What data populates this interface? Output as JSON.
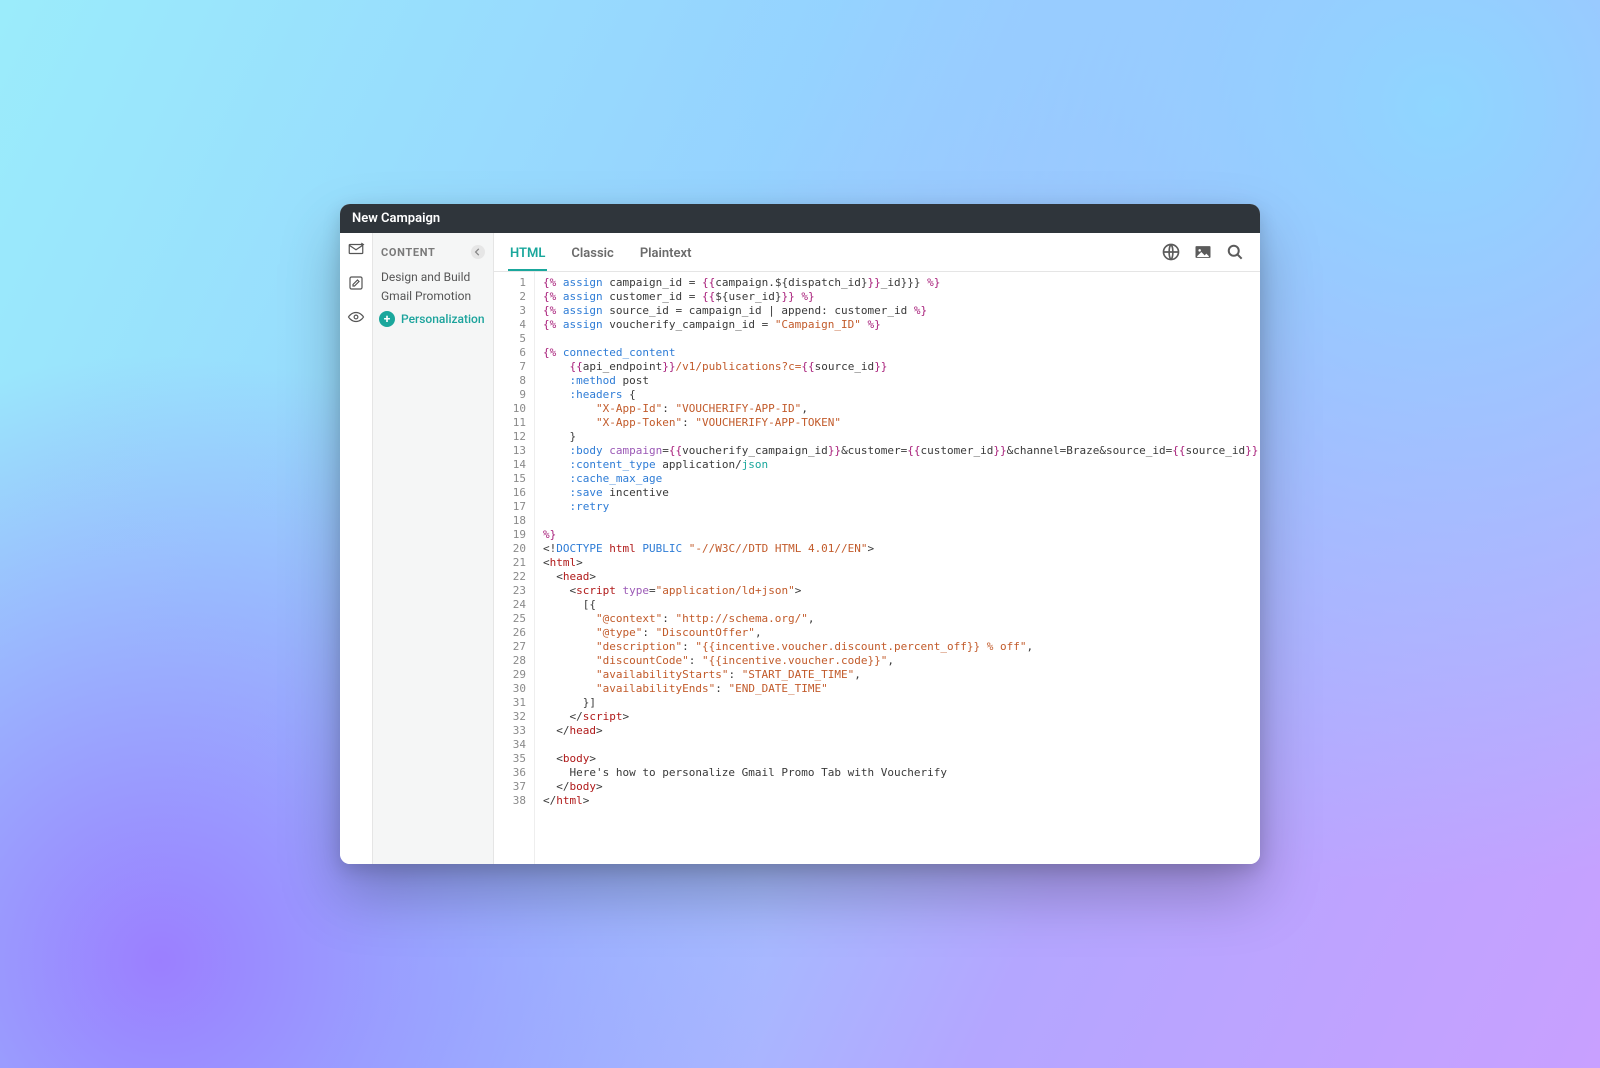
{
  "window": {
    "title": "New Campaign"
  },
  "panel": {
    "header": "CONTENT",
    "items": [
      "Design and Build",
      "Gmail Promotion",
      "Personalization"
    ]
  },
  "tabs": {
    "items": [
      "HTML",
      "Classic",
      "Plaintext"
    ],
    "active_index": 0
  },
  "code": {
    "lines": [
      [
        {
          "c": "c-punc",
          "t": "{% "
        },
        {
          "c": "c-key",
          "t": "assign"
        },
        {
          "c": "c-plain",
          "t": " campaign_id = "
        },
        {
          "c": "c-punc",
          "t": "{{"
        },
        {
          "c": "c-plain",
          "t": "campaign.${dispatch_id}"
        },
        {
          "c": "c-punc",
          "t": "}}"
        },
        {
          "c": "c-plain",
          "t": "_id}}} "
        },
        {
          "c": "c-punc",
          "t": "%}"
        }
      ],
      [
        {
          "c": "c-punc",
          "t": "{% "
        },
        {
          "c": "c-key",
          "t": "assign"
        },
        {
          "c": "c-plain",
          "t": " customer_id = "
        },
        {
          "c": "c-punc",
          "t": "{{"
        },
        {
          "c": "c-plain",
          "t": "${user_id}"
        },
        {
          "c": "c-punc",
          "t": "}}"
        },
        {
          "c": "c-plain",
          "t": " "
        },
        {
          "c": "c-punc",
          "t": "%}"
        }
      ],
      [
        {
          "c": "c-punc",
          "t": "{% "
        },
        {
          "c": "c-key",
          "t": "assign"
        },
        {
          "c": "c-plain",
          "t": " source_id = campaign_id | append: customer_id "
        },
        {
          "c": "c-punc",
          "t": "%}"
        }
      ],
      [
        {
          "c": "c-punc",
          "t": "{% "
        },
        {
          "c": "c-key",
          "t": "assign"
        },
        {
          "c": "c-plain",
          "t": " voucherify_campaign_id = "
        },
        {
          "c": "c-str",
          "t": "\"Campaign_ID\""
        },
        {
          "c": "c-plain",
          "t": " "
        },
        {
          "c": "c-punc",
          "t": "%}"
        }
      ],
      [
        {
          "c": "c-plain",
          "t": ""
        }
      ],
      [
        {
          "c": "c-punc",
          "t": "{% "
        },
        {
          "c": "c-key",
          "t": "connected_content"
        }
      ],
      [
        {
          "c": "c-plain",
          "t": "    "
        },
        {
          "c": "c-punc",
          "t": "{{"
        },
        {
          "c": "c-plain",
          "t": "api_endpoint"
        },
        {
          "c": "c-punc",
          "t": "}}"
        },
        {
          "c": "c-orange",
          "t": "/v1/publications?c="
        },
        {
          "c": "c-punc",
          "t": "{{"
        },
        {
          "c": "c-plain",
          "t": "source_id"
        },
        {
          "c": "c-punc",
          "t": "}}"
        }
      ],
      [
        {
          "c": "c-plain",
          "t": "    "
        },
        {
          "c": "c-key",
          "t": ":method"
        },
        {
          "c": "c-plain",
          "t": " post"
        }
      ],
      [
        {
          "c": "c-plain",
          "t": "    "
        },
        {
          "c": "c-key",
          "t": ":headers"
        },
        {
          "c": "c-plain",
          "t": " {"
        }
      ],
      [
        {
          "c": "c-plain",
          "t": "        "
        },
        {
          "c": "c-str",
          "t": "\"X-App-Id\""
        },
        {
          "c": "c-plain",
          "t": ": "
        },
        {
          "c": "c-str",
          "t": "\"VOUCHERIFY-APP-ID\""
        },
        {
          "c": "c-plain",
          "t": ","
        }
      ],
      [
        {
          "c": "c-plain",
          "t": "        "
        },
        {
          "c": "c-str",
          "t": "\"X-App-Token\""
        },
        {
          "c": "c-plain",
          "t": ": "
        },
        {
          "c": "c-str",
          "t": "\"VOUCHERIFY-APP-TOKEN\""
        }
      ],
      [
        {
          "c": "c-plain",
          "t": "    }"
        }
      ],
      [
        {
          "c": "c-plain",
          "t": "    "
        },
        {
          "c": "c-key",
          "t": ":body"
        },
        {
          "c": "c-plain",
          "t": " "
        },
        {
          "c": "c-attr",
          "t": "campaign"
        },
        {
          "c": "c-plain",
          "t": "="
        },
        {
          "c": "c-punc",
          "t": "{{"
        },
        {
          "c": "c-plain",
          "t": "voucherify_campaign_id"
        },
        {
          "c": "c-punc",
          "t": "}}"
        },
        {
          "c": "c-plain",
          "t": "&customer="
        },
        {
          "c": "c-punc",
          "t": "{{"
        },
        {
          "c": "c-plain",
          "t": "customer_id"
        },
        {
          "c": "c-punc",
          "t": "}}"
        },
        {
          "c": "c-plain",
          "t": "&channel=Braze&source_id="
        },
        {
          "c": "c-punc",
          "t": "{"
        },
        {
          "c": "c-punc",
          "t": "{"
        },
        {
          "c": "c-plain",
          "t": "source_id"
        },
        {
          "c": "c-punc",
          "t": "}"
        },
        {
          "c": "c-punc",
          "t": "}"
        }
      ],
      [
        {
          "c": "c-plain",
          "t": "    "
        },
        {
          "c": "c-key",
          "t": ":content_type"
        },
        {
          "c": "c-plain",
          "t": " application/"
        },
        {
          "c": "c-teal",
          "t": "json"
        }
      ],
      [
        {
          "c": "c-plain",
          "t": "    "
        },
        {
          "c": "c-key",
          "t": ":cache_max_age"
        }
      ],
      [
        {
          "c": "c-plain",
          "t": "    "
        },
        {
          "c": "c-key",
          "t": ":save"
        },
        {
          "c": "c-plain",
          "t": " incentive"
        }
      ],
      [
        {
          "c": "c-plain",
          "t": "    "
        },
        {
          "c": "c-key",
          "t": ":retry"
        }
      ],
      [
        {
          "c": "c-plain",
          "t": ""
        }
      ],
      [
        {
          "c": "c-punc",
          "t": "%}"
        }
      ],
      [
        {
          "c": "c-plain",
          "t": "<!"
        },
        {
          "c": "c-tag",
          "t": "DOCTYPE"
        },
        {
          "c": "c-plain",
          "t": " "
        },
        {
          "c": "c-tagred",
          "t": "html"
        },
        {
          "c": "c-plain",
          "t": " "
        },
        {
          "c": "c-tag",
          "t": "PUBLIC"
        },
        {
          "c": "c-plain",
          "t": " "
        },
        {
          "c": "c-str",
          "t": "\"-//W3C//DTD HTML 4.01//EN\""
        },
        {
          "c": "c-plain",
          "t": ">"
        }
      ],
      [
        {
          "c": "c-plain",
          "t": "<"
        },
        {
          "c": "c-tagred",
          "t": "html"
        },
        {
          "c": "c-plain",
          "t": ">"
        }
      ],
      [
        {
          "c": "c-plain",
          "t": "  <"
        },
        {
          "c": "c-tagred",
          "t": "head"
        },
        {
          "c": "c-plain",
          "t": ">"
        }
      ],
      [
        {
          "c": "c-plain",
          "t": "    <"
        },
        {
          "c": "c-tagred",
          "t": "script"
        },
        {
          "c": "c-plain",
          "t": " "
        },
        {
          "c": "c-attr",
          "t": "type"
        },
        {
          "c": "c-plain",
          "t": "="
        },
        {
          "c": "c-str",
          "t": "\"application/ld+json\""
        },
        {
          "c": "c-plain",
          "t": ">"
        }
      ],
      [
        {
          "c": "c-plain",
          "t": "      [{"
        }
      ],
      [
        {
          "c": "c-plain",
          "t": "        "
        },
        {
          "c": "c-str",
          "t": "\"@context\""
        },
        {
          "c": "c-plain",
          "t": ": "
        },
        {
          "c": "c-str",
          "t": "\"http://schema.org/\""
        },
        {
          "c": "c-plain",
          "t": ","
        }
      ],
      [
        {
          "c": "c-plain",
          "t": "        "
        },
        {
          "c": "c-str",
          "t": "\"@type\""
        },
        {
          "c": "c-plain",
          "t": ": "
        },
        {
          "c": "c-str",
          "t": "\"DiscountOffer\""
        },
        {
          "c": "c-plain",
          "t": ","
        }
      ],
      [
        {
          "c": "c-plain",
          "t": "        "
        },
        {
          "c": "c-str",
          "t": "\"description\""
        },
        {
          "c": "c-plain",
          "t": ": "
        },
        {
          "c": "c-str",
          "t": "\"{{incentive.voucher.discount.percent_off}} % off\""
        },
        {
          "c": "c-plain",
          "t": ","
        }
      ],
      [
        {
          "c": "c-plain",
          "t": "        "
        },
        {
          "c": "c-str",
          "t": "\"discountCode\""
        },
        {
          "c": "c-plain",
          "t": ": "
        },
        {
          "c": "c-str",
          "t": "\"{{incentive.voucher.code}}\""
        },
        {
          "c": "c-plain",
          "t": ","
        }
      ],
      [
        {
          "c": "c-plain",
          "t": "        "
        },
        {
          "c": "c-str",
          "t": "\"availabilityStarts\""
        },
        {
          "c": "c-plain",
          "t": ": "
        },
        {
          "c": "c-str",
          "t": "\"START_DATE_TIME\""
        },
        {
          "c": "c-plain",
          "t": ","
        }
      ],
      [
        {
          "c": "c-plain",
          "t": "        "
        },
        {
          "c": "c-str",
          "t": "\"availabilityEnds\""
        },
        {
          "c": "c-plain",
          "t": ": "
        },
        {
          "c": "c-str",
          "t": "\"END_DATE_TIME\""
        }
      ],
      [
        {
          "c": "c-plain",
          "t": "      }]"
        }
      ],
      [
        {
          "c": "c-plain",
          "t": "    </"
        },
        {
          "c": "c-tagred",
          "t": "script"
        },
        {
          "c": "c-plain",
          "t": ">"
        }
      ],
      [
        {
          "c": "c-plain",
          "t": "  </"
        },
        {
          "c": "c-tagred",
          "t": "head"
        },
        {
          "c": "c-plain",
          "t": ">"
        }
      ],
      [
        {
          "c": "c-plain",
          "t": ""
        }
      ],
      [
        {
          "c": "c-plain",
          "t": "  <"
        },
        {
          "c": "c-tagred",
          "t": "body"
        },
        {
          "c": "c-plain",
          "t": ">"
        }
      ],
      [
        {
          "c": "c-plain",
          "t": "    Here's how to personalize Gmail Promo Tab with Voucherify"
        }
      ],
      [
        {
          "c": "c-plain",
          "t": "  </"
        },
        {
          "c": "c-tagred",
          "t": "body"
        },
        {
          "c": "c-plain",
          "t": ">"
        }
      ],
      [
        {
          "c": "c-plain",
          "t": "</"
        },
        {
          "c": "c-tagred",
          "t": "html"
        },
        {
          "c": "c-plain",
          "t": ">"
        }
      ]
    ]
  }
}
